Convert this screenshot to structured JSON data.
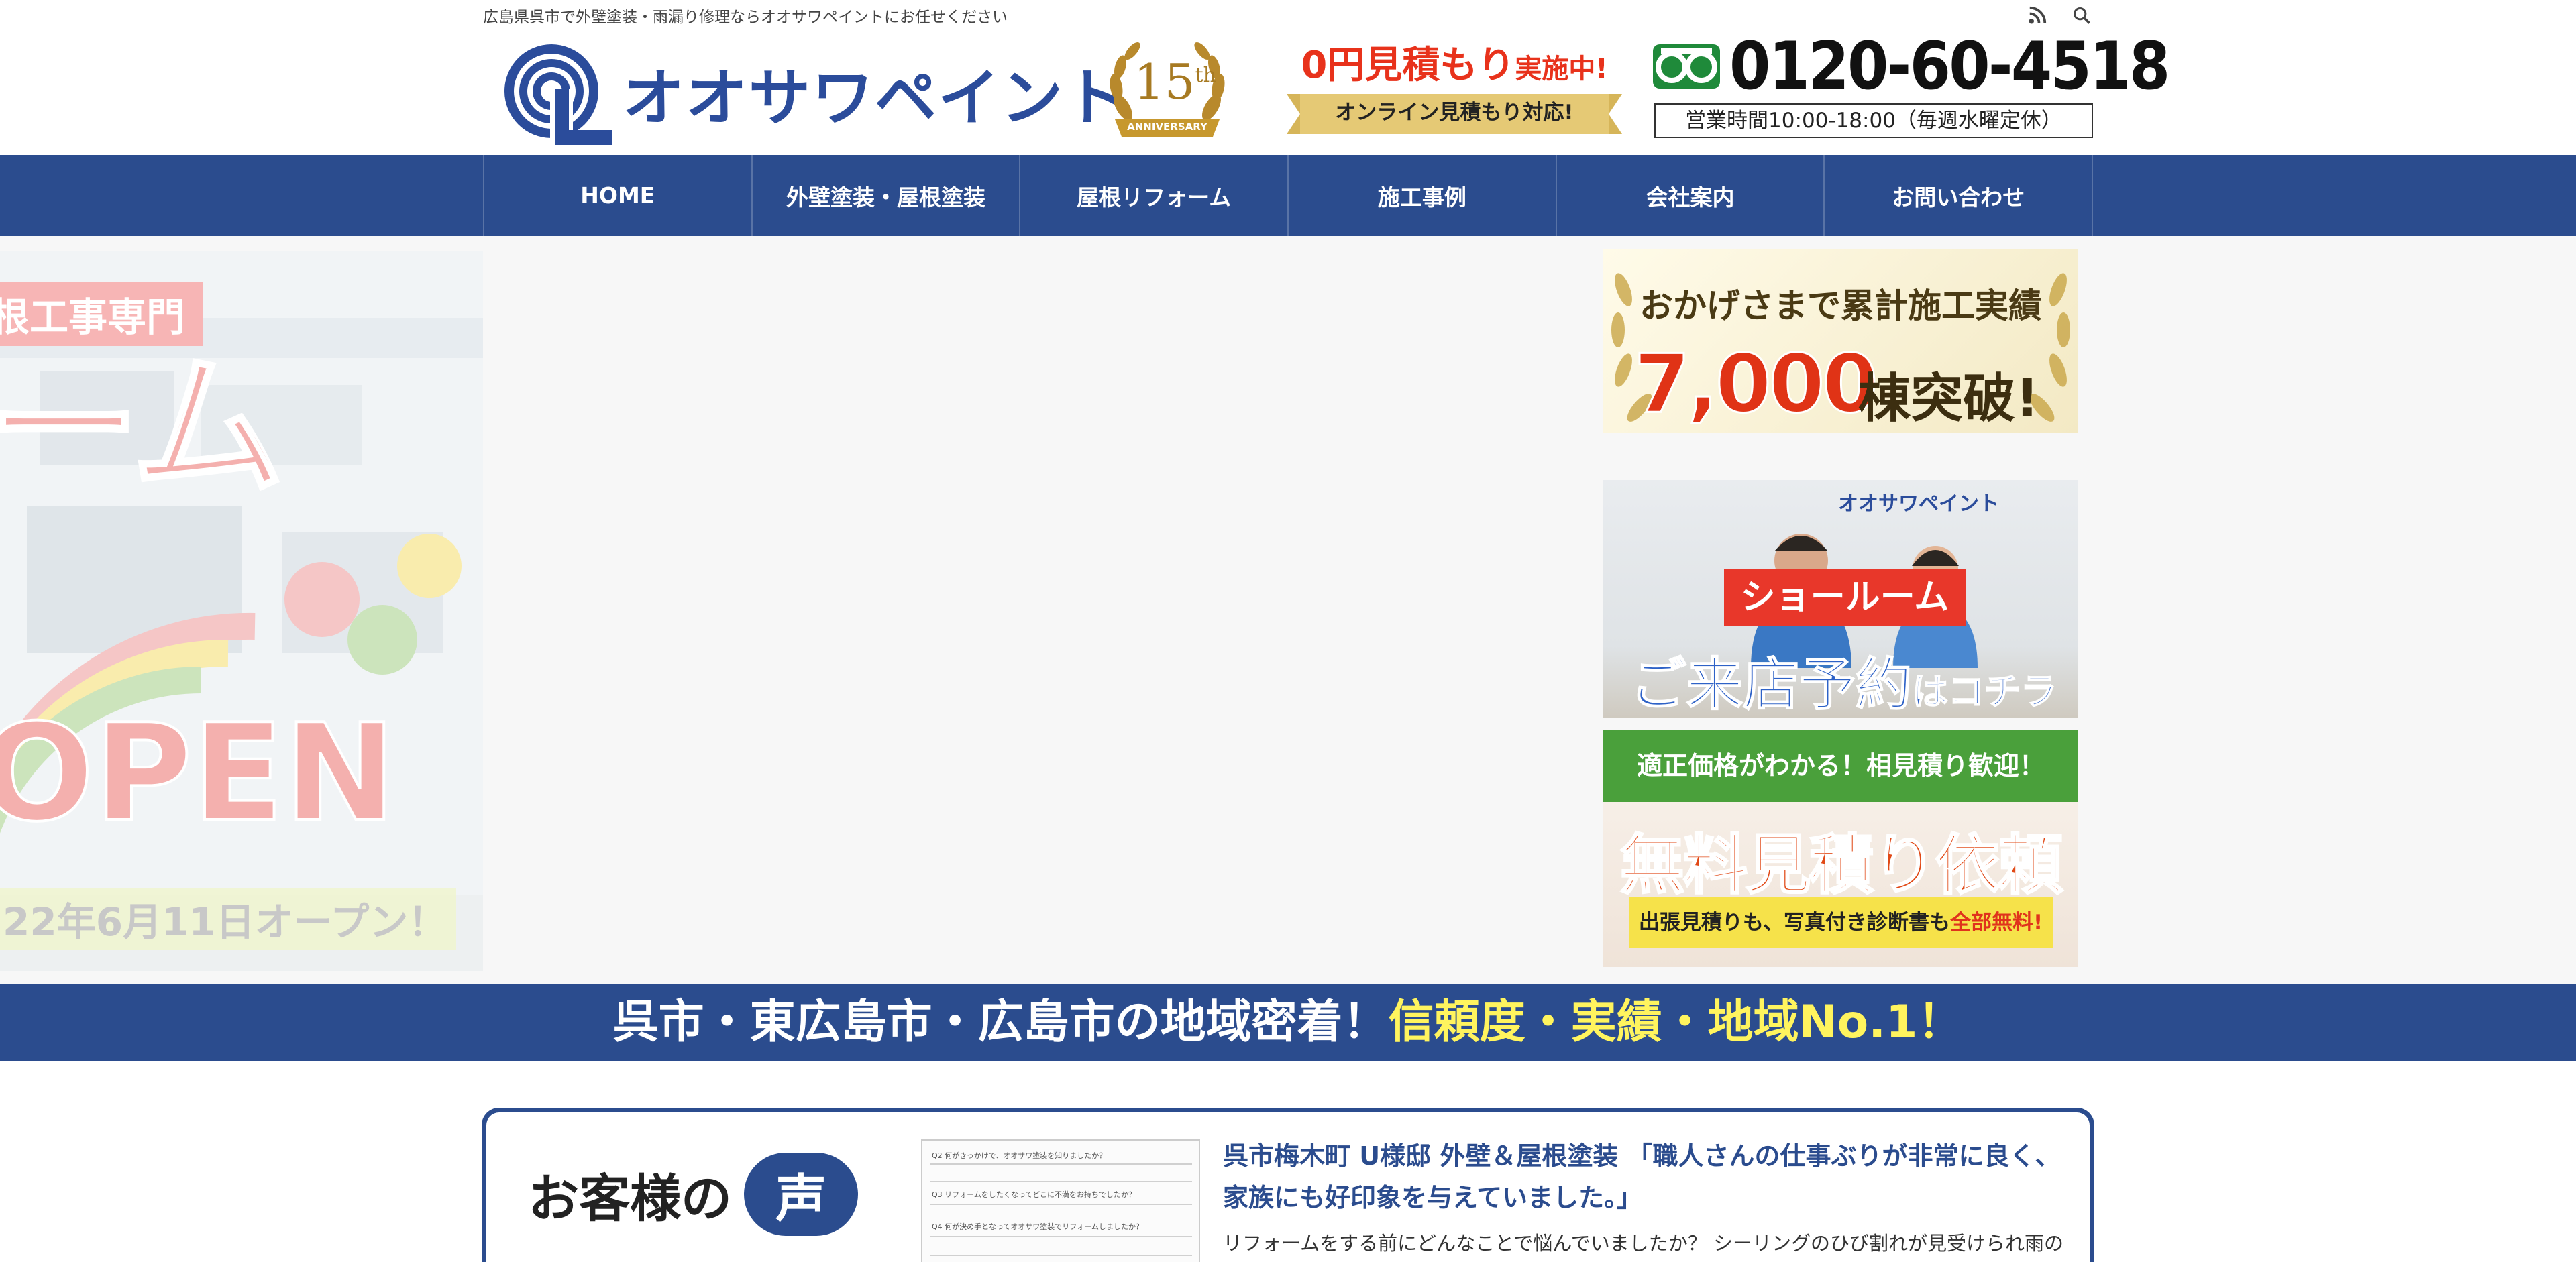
{
  "header": {
    "tagline": "広島県呉市で外壁塗装・雨漏り修理ならオオサワペイントにお任せください",
    "logo_text": "オオサワペイント",
    "anniversary": {
      "number": "15",
      "suffix": "th",
      "label": "ANNIVERSARY"
    },
    "estimate": {
      "title_main": "0円見積もり",
      "title_small": "実施中!",
      "subtitle": "オンライン見積もり対応!"
    },
    "phone": "0120-60-4518",
    "hours": "営業時間10:00-18:00（毎週水曜定休）",
    "icons": [
      "rss-icon",
      "search-icon"
    ]
  },
  "nav": {
    "items": [
      {
        "label": "HOME"
      },
      {
        "label": "外壁塗装・屋根塗装"
      },
      {
        "label": "屋根リフォーム"
      },
      {
        "label": "施工事例"
      },
      {
        "label": "会社案内"
      },
      {
        "label": "お問い合わせ"
      }
    ]
  },
  "slider": {
    "tag": "根工事専門",
    "title": "ーム",
    "open": "OPEN",
    "date": "22年6月11日オープン！"
  },
  "banners": {
    "achievement": {
      "line1": "おかげさまで累計施工実績",
      "number": "7,000",
      "suffix": "棟突破!"
    },
    "showroom": {
      "logo": "オオサワペイント",
      "label": "ショールーム",
      "cta_main": "ご来店予約",
      "cta_small": "はコチラ"
    },
    "free_estimate": {
      "head": "適正価格がわかる！相見積り歓迎！",
      "title": "無料見積り依頼",
      "note_main": "出張見積りも、写真付き診断書も",
      "note_accent": "全部無料!"
    }
  },
  "slogan": {
    "main": "呉市・東広島市・広島市の地域密着！",
    "accent": "信頼度・実績・地域No.1！"
  },
  "voice": {
    "heading": "お客様の",
    "badge": "声",
    "more": "",
    "title": "呉市梅木町 U様邸 外壁＆屋根塗装 「職人さんの仕事ぶりが非常に良く、家族にも好印象を与えていました。」",
    "excerpt": "リフォームをする前にどんなことで悩んでいましたか？ シーリングのひび割れが見受けられ雨の",
    "sheet_lines": [
      "Q2 何がきっかけで、オオサワ塗装を知りましたか？",
      "Q3 リフォームをしたくなってどこに不満をお持ちでしたか？",
      "Q4 何が決め手となってオオサワ塗装でリフォームしましたか？"
    ]
  },
  "colors": {
    "brand_blue": "#2b4c8e",
    "accent_red": "#e8321b",
    "accent_yellow": "#fff45e",
    "green": "#4aa03b"
  }
}
